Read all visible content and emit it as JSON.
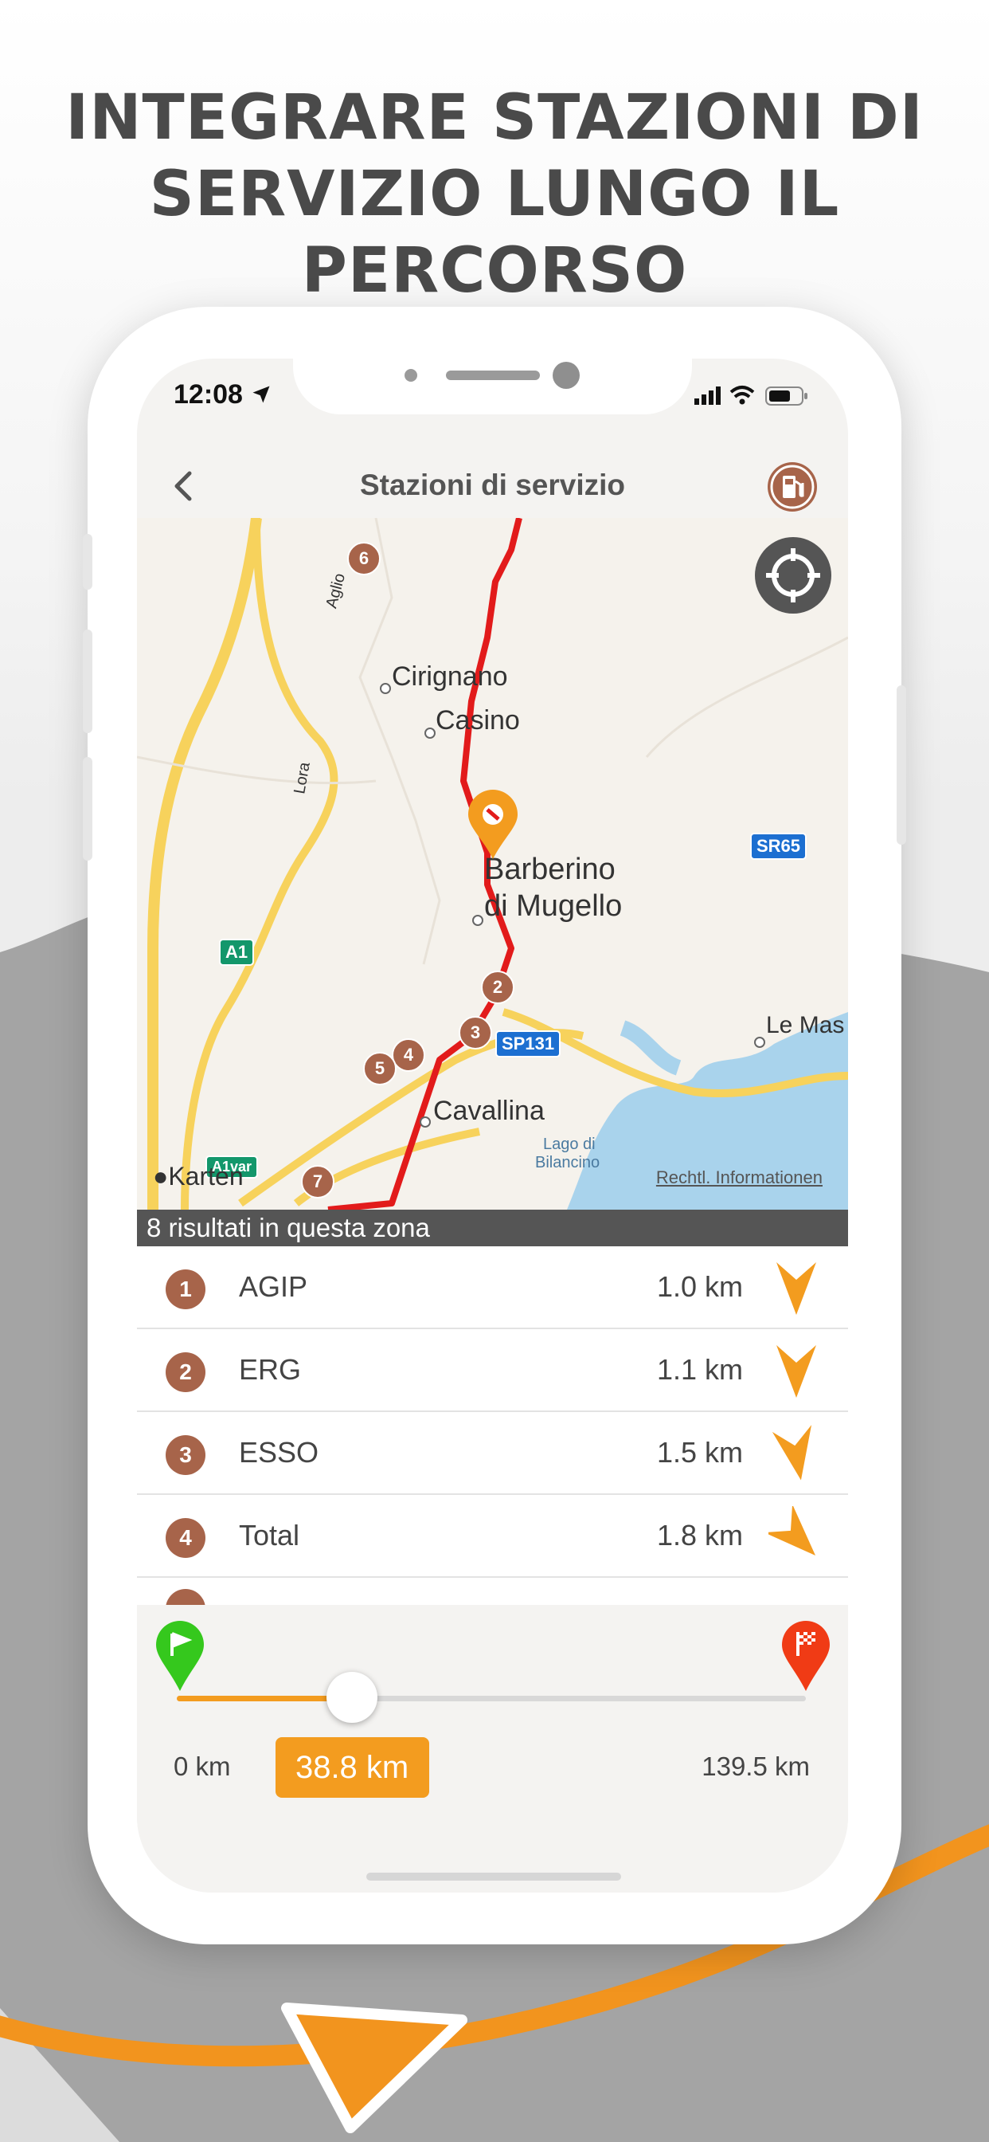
{
  "headline": {
    "line1": "INTEGRARE STAZIONI DI",
    "line2": "SERVIZIO LUNGO IL PERCORSO"
  },
  "status_bar": {
    "time": "12:08"
  },
  "nav": {
    "title": "Stazioni di servizio",
    "back_icon": "chevron-left-icon",
    "action_icon": "fuel-pump-icon"
  },
  "map": {
    "places": [
      "Cirignano",
      "Casino",
      "Barberino",
      "di Mugello",
      "Cavallina",
      "Le Mas",
      "Lago di",
      "Bilancino",
      "Lora",
      "Aglio"
    ],
    "roads": [
      "SR65",
      "SP131",
      "A1",
      "A1var"
    ],
    "attribution": "Karten",
    "legal_link": "Rechtl. Informationen",
    "pins": [
      "2",
      "3",
      "4",
      "5",
      "6",
      "7"
    ],
    "locate_icon": "crosshair-icon"
  },
  "results_banner": "8 risultati in questa zona",
  "stations": [
    {
      "num": "1",
      "name": "AGIP",
      "dist": "1.0 km"
    },
    {
      "num": "2",
      "name": "ERG",
      "dist": "1.1 km"
    },
    {
      "num": "3",
      "name": "ESSO",
      "dist": "1.5 km"
    },
    {
      "num": "4",
      "name": "Total",
      "dist": "1.8 km"
    }
  ],
  "slider": {
    "min_label": "0 km",
    "max_label": "139.5 km",
    "current_label": "38.8 km",
    "value_fraction": 0.278,
    "start_icon": "start-flag-icon",
    "end_icon": "finish-flag-icon"
  },
  "colors": {
    "accent": "#f39c1f",
    "route": "#e21b1b",
    "badge": "#a7644a"
  }
}
